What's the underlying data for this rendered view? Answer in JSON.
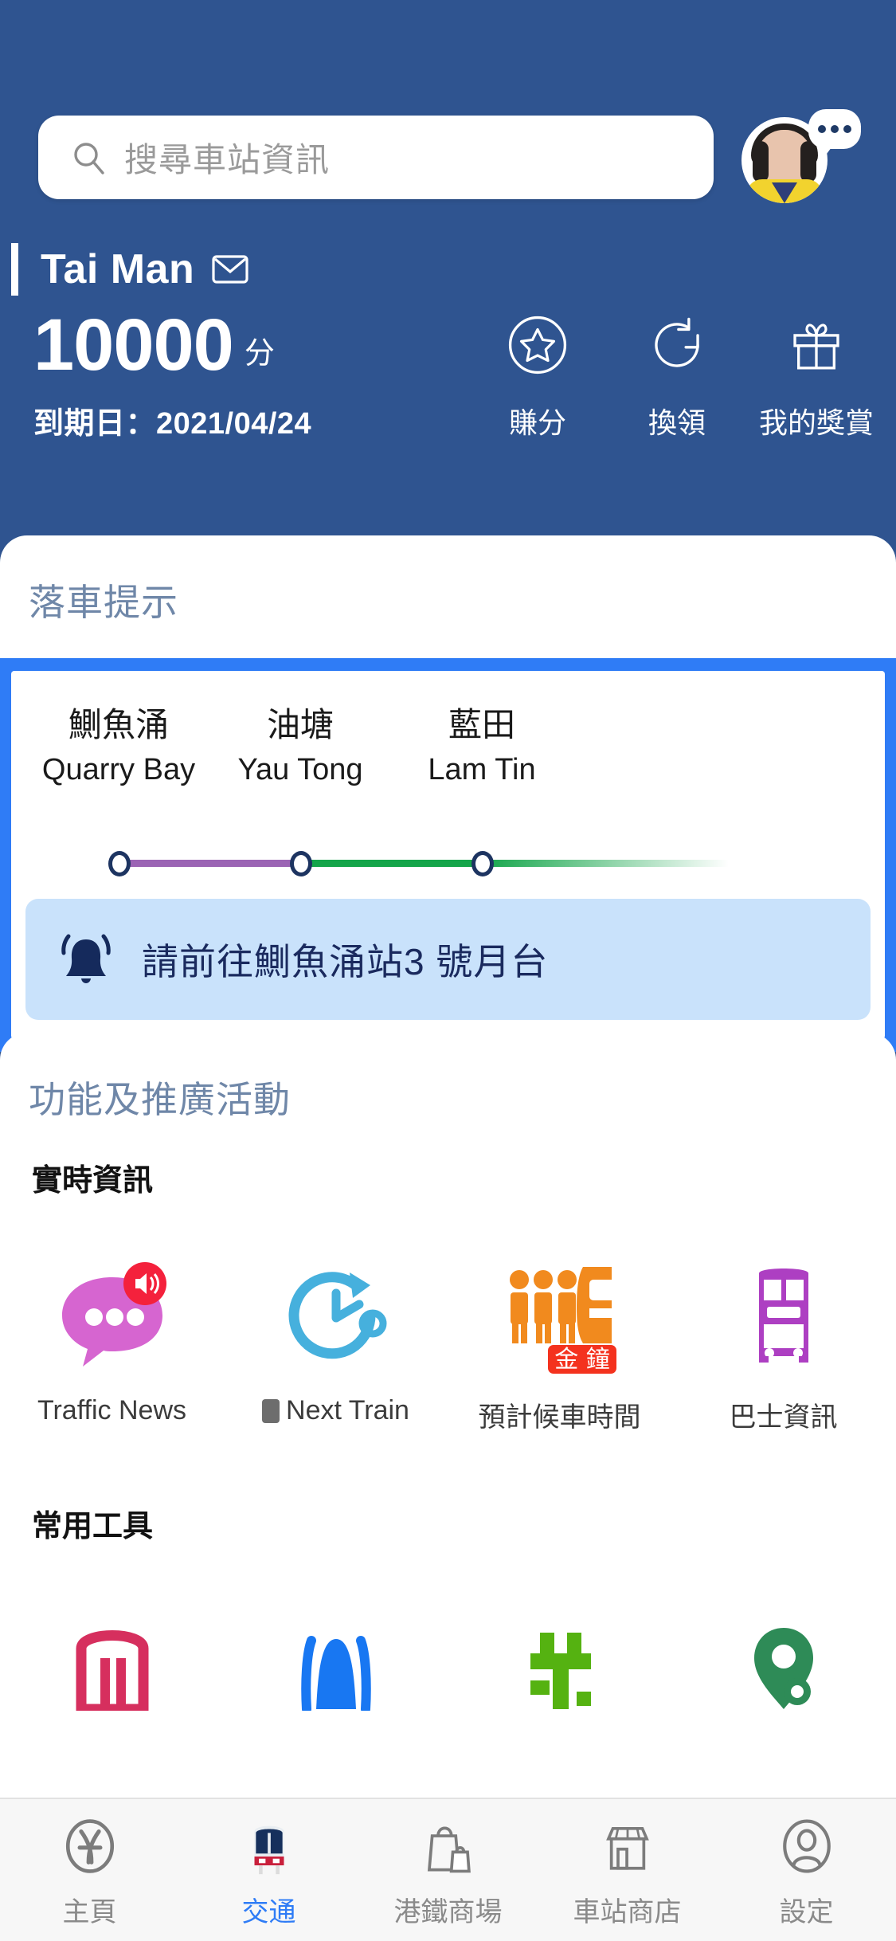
{
  "theme": {
    "header_bg": "#2f5490",
    "accent_blue": "#2f7cf6",
    "card_title_color": "#6f87a8",
    "alert_bg": "#c9e2fb",
    "alert_text_color": "#1a2a5e",
    "line_purple": "#9b64b4",
    "line_green": "#14a54a"
  },
  "search": {
    "placeholder": "搜尋車站資訊",
    "icon": "search-icon"
  },
  "avatar": {
    "name": "avatar",
    "chat_icon": "chat-bubble-icon"
  },
  "account": {
    "username": "Tai Man",
    "mail_icon": "envelope-icon",
    "points_value": "10000",
    "points_unit": "分",
    "expiry_label": "到期日：2021/04/24"
  },
  "quick_actions": [
    {
      "label": "賺分",
      "icon": "star-circle-icon"
    },
    {
      "label": "換領",
      "icon": "refresh-icon"
    },
    {
      "label": "我的獎賞",
      "icon": "gift-icon"
    }
  ],
  "alight_card": {
    "title": "落車提示",
    "stations": [
      {
        "zh": "鰂魚涌",
        "en": "Quarry Bay"
      },
      {
        "zh": "油塘",
        "en": "Yau Tong"
      },
      {
        "zh": "藍田",
        "en": "Lam Tin"
      }
    ],
    "alert": {
      "icon": "bell-ringing-icon",
      "text": "請前往鰂魚涌站3 號月台"
    }
  },
  "features_card": {
    "title": "功能及推廣活動",
    "realtime": {
      "heading": "實時資訊",
      "items": [
        {
          "label": "Traffic News",
          "icon": "speech-bubble-speaker-icon",
          "badge": ""
        },
        {
          "label": "Next Train",
          "icon": "clock-arrow-icon",
          "badge": ""
        },
        {
          "label": "預計候車時間",
          "icon": "crowd-train-icon",
          "badge": "金 鐘"
        },
        {
          "label": "巴士資訊",
          "icon": "double-decker-bus-icon",
          "badge": ""
        }
      ]
    },
    "tools": {
      "heading": "常用工具",
      "items": [
        {
          "icon": "fare-gate-icon"
        },
        {
          "icon": "umbrella-icon"
        },
        {
          "icon": "puzzle-icon"
        },
        {
          "icon": "location-pin-icon"
        }
      ]
    }
  },
  "tabbar": [
    {
      "label": "主頁",
      "icon": "mtr-logo-icon",
      "active": false
    },
    {
      "label": "交通",
      "icon": "train-icon",
      "active": true
    },
    {
      "label": "港鐵商場",
      "icon": "shopping-bag-icon",
      "active": false
    },
    {
      "label": "車站商店",
      "icon": "storefront-icon",
      "active": false
    },
    {
      "label": "設定",
      "icon": "user-circle-icon",
      "active": false
    }
  ]
}
